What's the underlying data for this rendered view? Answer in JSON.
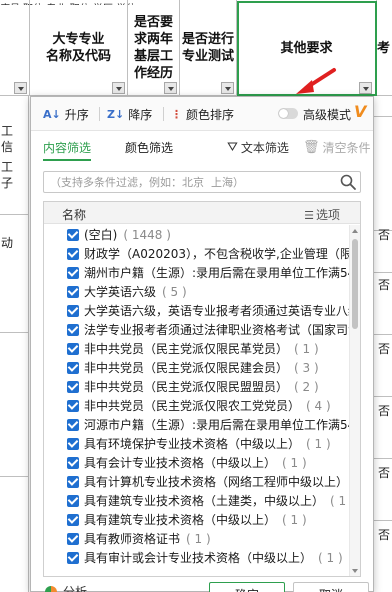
{
  "sheet": {
    "top_strip_text": "序号  职位   专业/职位   学历 学位",
    "headers": [
      {
        "label": "大专专业\n名称及代码"
      },
      {
        "label": "是否要\n求两年\n基层工\n作经历"
      },
      {
        "label": "是否进行\n专业测试"
      },
      {
        "label": "其他要求"
      },
      {
        "label": "考"
      }
    ],
    "left_col_text": [
      "工",
      "信",
      "",
      "工",
      "子",
      "动"
    ],
    "right_col_text": [
      "否",
      "否",
      "否",
      "否",
      "否",
      "否",
      "否",
      "否",
      "否"
    ]
  },
  "panel": {
    "sort": {
      "asc_icon": "sort-asc-icon",
      "asc_label": "升序",
      "desc_icon": "sort-desc-icon",
      "desc_label": "降序",
      "color_icon": "color-sort-icon",
      "color_label": "颜色排序",
      "advanced_label": "高级模式",
      "vip_badge": "V"
    },
    "tabs": {
      "content_filter": "内容筛选",
      "color_filter": "颜色筛选",
      "text_filter": "文本筛选",
      "clear_filter": "清空条件"
    },
    "search": {
      "placeholder": "（支持多条件过滤，例如：北京  上海）",
      "value": ""
    },
    "list": {
      "column_name": "名称",
      "options_label": "选项",
      "items": [
        {
          "label": "(空白)",
          "count": "( 1448 )"
        },
        {
          "label": "财政学（A020203），不包含税收学,企业管理（限:",
          "count": ""
        },
        {
          "label": "潮州市户籍（生源）:录用后需在录用单位工作满54",
          "count": ""
        },
        {
          "label": "大学英语六级",
          "count": "( 5 )"
        },
        {
          "label": "大学英语六级，英语专业报考者须通过英语专业八级",
          "count": ""
        },
        {
          "label": "法学专业报考者须通过法律职业资格考试（国家司法",
          "count": ""
        },
        {
          "label": "非中共党员（民主党派仅限民革党员）",
          "count": "( 1 )"
        },
        {
          "label": "非中共党员（民主党派仅限民建会员）",
          "count": "( 3 )"
        },
        {
          "label": "非中共党员（民主党派仅限民盟盟员）",
          "count": "( 2 )"
        },
        {
          "label": "非中共党员（民主党派仅限农工党党员）",
          "count": "( 4 )"
        },
        {
          "label": "河源市户籍（生源）:录用后需在录用单位工作满54",
          "count": ""
        },
        {
          "label": "具有环境保护专业技术资格（中级以上）",
          "count": "( 1 )"
        },
        {
          "label": "具有会计专业技术资格（中级以上）",
          "count": "( 1 )"
        },
        {
          "label": "具有计算机专业技术资格（网络工程师中级以上）",
          "count": ""
        },
        {
          "label": "具有建筑专业技术资格（土建类，中级以上）",
          "count": "( 1"
        },
        {
          "label": "具有建筑专业技术资格（中级以上）",
          "count": "( 1 )"
        },
        {
          "label": "具有教师资格证书",
          "count": "( 1 )"
        },
        {
          "label": "具有审计或会计专业技术资格（中级以上）",
          "count": "( 1 )"
        }
      ]
    },
    "footer": {
      "analysis_label": "分析",
      "ok_label": "确定",
      "cancel_label": "取消"
    }
  },
  "colors": {
    "accent_green": "#2e9f4e",
    "checkbox_blue": "#1f6fd0",
    "vip_orange": "#f08c1e",
    "arrow_red": "#e02020"
  }
}
